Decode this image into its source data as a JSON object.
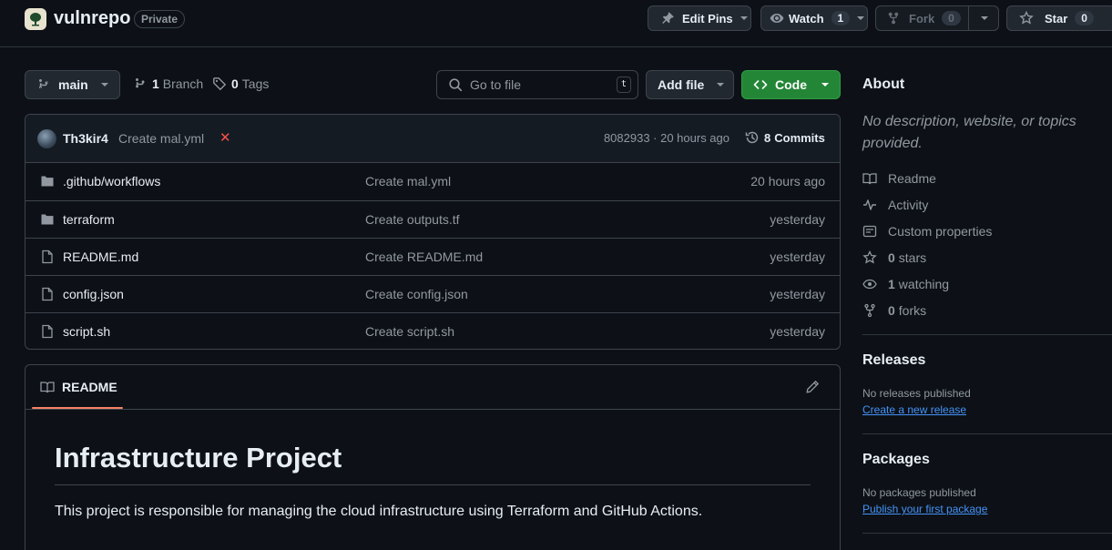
{
  "repo": {
    "name": "vulnrepo",
    "visibility": "Private"
  },
  "header_actions": {
    "edit_pins": "Edit Pins",
    "watch": {
      "label": "Watch",
      "count": "1"
    },
    "fork": {
      "label": "Fork",
      "count": "0"
    },
    "star": {
      "label": "Star",
      "count": "0"
    }
  },
  "toolbar": {
    "branch": "main",
    "branches": {
      "count": "1",
      "label": "Branch"
    },
    "tags": {
      "count": "0",
      "label": "Tags"
    },
    "search_placeholder": "Go to file",
    "search_shortcut": "t",
    "add_file": "Add file",
    "code": "Code"
  },
  "latest_commit": {
    "author": "Th3kir4",
    "message": "Create mal.yml",
    "status": "✕",
    "hash_time": "8082933 · 20 hours ago",
    "commits_count": "8",
    "commits_label": "Commits"
  },
  "files": [
    {
      "type": "folder",
      "name": ".github/workflows",
      "message": "Create mal.yml",
      "date": "20 hours ago"
    },
    {
      "type": "folder",
      "name": "terraform",
      "message": "Create outputs.tf",
      "date": "yesterday"
    },
    {
      "type": "file",
      "name": "README.md",
      "message": "Create README.md",
      "date": "yesterday"
    },
    {
      "type": "file",
      "name": "config.json",
      "message": "Create config.json",
      "date": "yesterday"
    },
    {
      "type": "file",
      "name": "script.sh",
      "message": "Create script.sh",
      "date": "yesterday"
    }
  ],
  "readme": {
    "tab": "README",
    "heading": "Infrastructure Project",
    "paragraph": "This project is responsible for managing the cloud infrastructure using Terraform and GitHub Actions."
  },
  "about": {
    "title": "About",
    "description": "No description, website, or topics provided.",
    "links": [
      {
        "icon": "book-icon",
        "bold": "",
        "label": "Readme"
      },
      {
        "icon": "pulse-icon",
        "bold": "",
        "label": "Activity"
      },
      {
        "icon": "note-icon",
        "bold": "",
        "label": "Custom properties"
      },
      {
        "icon": "star-icon",
        "bold": "0",
        "label": "stars"
      },
      {
        "icon": "eye-icon",
        "bold": "1",
        "label": "watching"
      },
      {
        "icon": "fork-icon",
        "bold": "0",
        "label": "forks"
      }
    ]
  },
  "releases": {
    "title": "Releases",
    "empty": "No releases published",
    "link": "Create a new release"
  },
  "packages": {
    "title": "Packages",
    "empty": "No packages published",
    "link": "Publish your first package"
  },
  "colors": {
    "accent_green": "#238636",
    "link_blue": "#4493f8",
    "tab_underline": "#f78166",
    "error_red": "#f85149"
  }
}
